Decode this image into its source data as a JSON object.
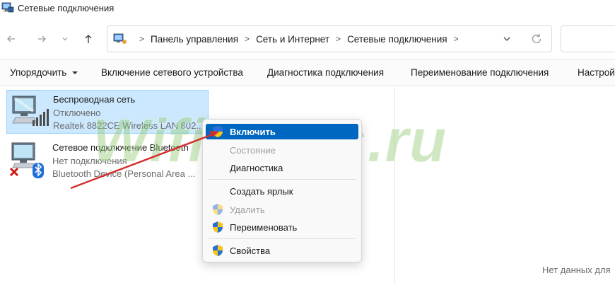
{
  "window": {
    "title": "Сетевые подключения"
  },
  "navigation": {
    "breadcrumbs": [
      "Панель управления",
      "Сеть и Интернет",
      "Сетевые подключения"
    ]
  },
  "toolbar": {
    "organize": "Упорядочить",
    "enable_device": "Включение сетевого устройства",
    "diagnose": "Диагностика подключения",
    "rename": "Переименование подключения",
    "settings_truncated": "Настрой"
  },
  "connections": [
    {
      "name": "Беспроводная сеть",
      "status": "Отключено",
      "device": "Realtek 8822CE Wireless LAN 802...",
      "icon": "wireless-adapter-icon",
      "selected": true
    },
    {
      "name": "Сетевое подключение Bluetooth",
      "status": "Нет подключения",
      "device": "Bluetooth Device (Personal Area ...",
      "icon": "bluetooth-adapter-icon",
      "selected": false
    }
  ],
  "context_menu": {
    "items": [
      {
        "label": "Включить",
        "shield": true,
        "highlighted": true,
        "disabled": false
      },
      {
        "label": "Состояние",
        "shield": false,
        "highlighted": false,
        "disabled": true
      },
      {
        "label": "Диагностика",
        "shield": false,
        "highlighted": false,
        "disabled": false
      },
      {
        "label": "Создать ярлык",
        "shield": false,
        "highlighted": false,
        "disabled": false
      },
      {
        "label": "Удалить",
        "shield": true,
        "highlighted": false,
        "disabled": true
      },
      {
        "label": "Переименовать",
        "shield": true,
        "highlighted": false,
        "disabled": false
      },
      {
        "label": "Свойства",
        "shield": true,
        "highlighted": false,
        "disabled": false
      }
    ]
  },
  "details_pane": {
    "empty_text": "Нет данных для"
  },
  "watermark": "WifiNews.ru",
  "colors": {
    "selection": "#cce8ff",
    "menu_highlight": "#0067c0",
    "annotation_arrow": "#d42c2c",
    "watermark": "#8cc86e"
  }
}
